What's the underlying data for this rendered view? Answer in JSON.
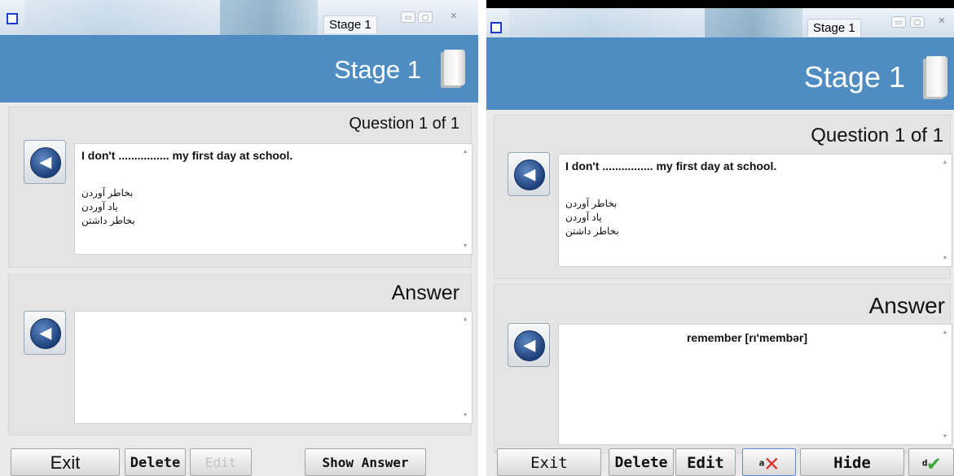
{
  "left": {
    "tab_title": "Stage 1",
    "header_title": "Stage 1",
    "question_counter": "Question 1 of 1",
    "question_text": "I don't ................ my first day at school.",
    "options": [
      "بخاطر آوردن",
      "یاد آوردن",
      "بخاطر داشتن"
    ],
    "answer_label": "Answer",
    "answer_text": "",
    "buttons": {
      "exit": "Exit",
      "delete": "Delete",
      "edit": "Edit",
      "show_answer": "Show Answer"
    }
  },
  "right": {
    "tab_title": "Stage 1",
    "header_title": "Stage 1",
    "question_counter": "Question 1 of 1",
    "question_text": "I don't ................ my first day at school.",
    "options": [
      "بخاطر آوردن",
      "یاد آوردن",
      "بخاطر داشتن"
    ],
    "answer_label": "Answer",
    "answer_text": "remember  [rı'membər]",
    "buttons": {
      "exit": "Exit",
      "delete": "Delete",
      "edit": "Edit",
      "wrong_prefix": "a",
      "hide": "Hide",
      "right_prefix": "d"
    }
  },
  "colors": {
    "header_blue": "#4f8cc2",
    "wrong_red": "#d9322a",
    "right_green": "#3aa63a"
  },
  "icons": {
    "speaker": "speaker-icon",
    "book": "book-icon",
    "wrong": "red-x-icon",
    "right": "green-check-icon"
  }
}
